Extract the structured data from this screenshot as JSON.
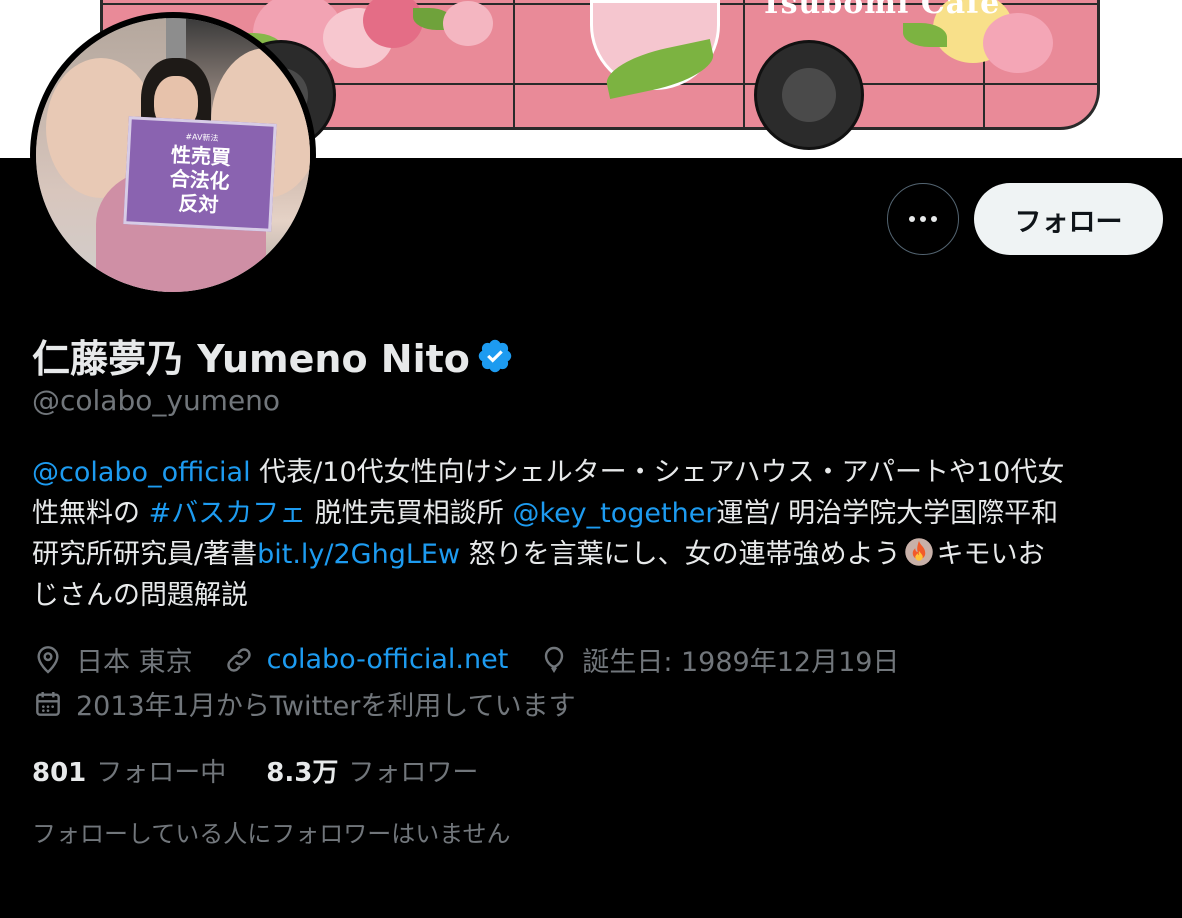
{
  "banner": {
    "bus_text": "Tsubomi Cafe"
  },
  "avatar": {
    "sign_small": "#AV新法",
    "sign_line1": "性売買",
    "sign_line2": "合法化",
    "sign_line3": "反対"
  },
  "actions": {
    "more_icon": "more-horizontal-icon",
    "follow_label": "フォロー"
  },
  "profile": {
    "display_name": "仁藤夢乃  Yumeno Nito",
    "verified_icon": "verified-badge-icon",
    "handle": "@colabo_yumeno"
  },
  "bio": {
    "line1_mention": "@colabo_official",
    "line1_text": " 代表/10代女性向けシェルター・シェアハウス・アパートや10代女",
    "line2_text1": "性無料の ",
    "line2_hashtag": "#バスカフェ",
    "line2_text2": " 脱性売買相談所 ",
    "line2_mention": "@key_together",
    "line2_text3": "運営/ 明治学院大学国際平和",
    "line3_text1": "研究所研究員/著書",
    "line3_link": "bit.ly/2GhgLEw",
    "line3_text2": " 怒りを言葉にし、女の連帯強めよう",
    "line3_text3": "キモいお",
    "line4_text": "じさんの問題解説"
  },
  "meta": {
    "location": "日本 東京",
    "website": "colabo-official.net",
    "birthday": "誕生日: 1989年12月19日",
    "joined": "2013年1月からTwitterを利用しています"
  },
  "stats": {
    "following_count": "801",
    "following_label": "フォロー中",
    "followers_count": "8.3万",
    "followers_label": "フォロワー"
  },
  "mutuals": {
    "text": "フォローしている人にフォロワーはいません"
  },
  "colors": {
    "background": "#000000",
    "text_primary": "#e7e9ea",
    "text_secondary": "#71767b",
    "link": "#1d9bf0",
    "follow_button_bg": "#eff3f4"
  }
}
